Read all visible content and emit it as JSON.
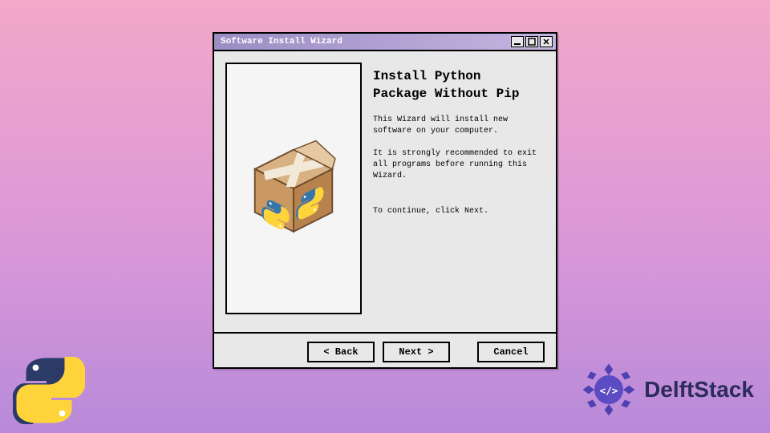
{
  "window": {
    "title": "Software Install Wizard"
  },
  "heading": {
    "line1": "Install Python",
    "line2": "Package Without Pip"
  },
  "body": {
    "para1": "This Wizard will install new software on your computer.",
    "para2": "It is strongly recommended to exit all programs before running this Wizard.",
    "para3": "To continue, click Next."
  },
  "buttons": {
    "back": "< Back",
    "next": "Next >",
    "cancel": "Cancel"
  },
  "brand": {
    "name": "DelftStack"
  },
  "colors": {
    "python_blue": "#3776ab",
    "python_yellow": "#ffd43b",
    "box_brown": "#c99863",
    "titlebar_start": "#9b8dc4"
  }
}
